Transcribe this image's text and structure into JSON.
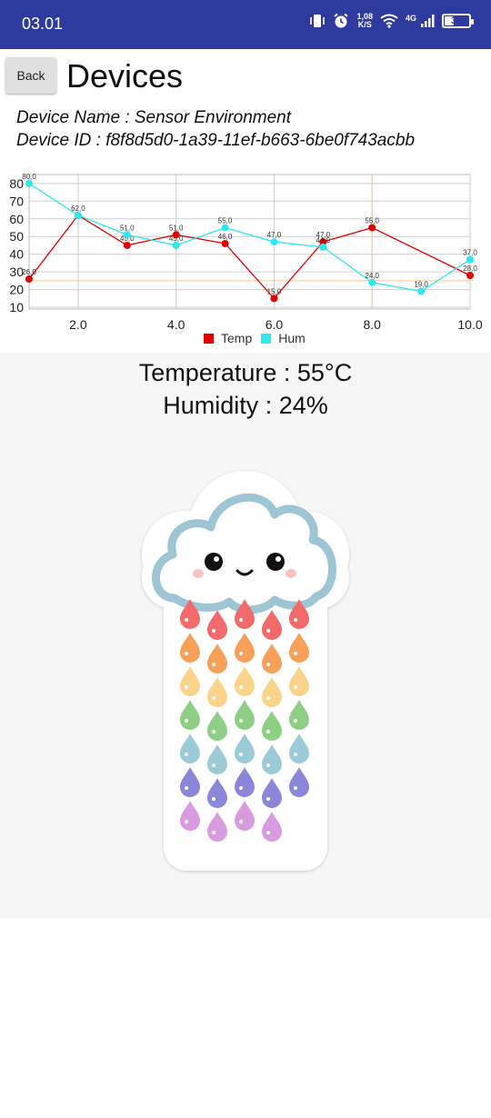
{
  "status_bar": {
    "time": "03.01",
    "net_speed_value": "1,08",
    "net_speed_unit": "K/S",
    "network_type": "4G",
    "battery_level": "37",
    "icons": [
      "vibrate-icon",
      "alarm-icon",
      "wifi-icon",
      "cellular-signal-icon",
      "battery-icon"
    ]
  },
  "header": {
    "back_label": "Back",
    "title": "Devices"
  },
  "device": {
    "name_line": "Device Name : Sensor Environment",
    "id_line": "Device ID : f8f8d5d0-1a39-11ef-b663-6be0f743acbb"
  },
  "chart_data": {
    "type": "line",
    "x": [
      1,
      2,
      3,
      4,
      5,
      6,
      7,
      8,
      9,
      10
    ],
    "x_ticks": [
      "2.0",
      "4.0",
      "6.0",
      "8.0",
      "10.0"
    ],
    "y_ticks": [
      "10",
      "20",
      "30",
      "40",
      "50",
      "60",
      "70",
      "80"
    ],
    "ylim": [
      9,
      83
    ],
    "xlim": [
      1,
      10
    ],
    "grid": true,
    "legend_position": "bottom-center",
    "series": [
      {
        "name": "Temp",
        "color": "#e30000",
        "values": [
          26,
          62,
          45,
          51,
          46,
          15,
          47,
          55,
          null,
          28
        ],
        "labels": [
          "26,0",
          "62,0",
          "45,0",
          "51,0",
          "46,0",
          "15,0",
          "47,0",
          "55,0",
          "",
          "28,0"
        ]
      },
      {
        "name": "Hum",
        "color": "#2ee8ec",
        "values": [
          80,
          62,
          51,
          45,
          55,
          47,
          44,
          24,
          19,
          37
        ],
        "labels": [
          "80,0",
          "",
          "51,0",
          "45,0",
          "55,0",
          "47,0",
          "44,0",
          "24,0",
          "19,0",
          "37,0"
        ]
      }
    ],
    "limit_lines": [
      {
        "axis": "y",
        "value": 25,
        "color": "#f0c890"
      },
      {
        "axis": "x",
        "value": 8,
        "color": "#f0c890"
      }
    ]
  },
  "legend": {
    "temp_label": "Temp",
    "hum_label": "Hum",
    "temp_color": "#e30000",
    "hum_color": "#2ee8ec"
  },
  "readings": {
    "temperature": "Temperature : 55°C",
    "humidity": "Humidity : 24%"
  },
  "illustration": {
    "icon": "rain-cloud-sticker-icon",
    "drop_colors": [
      "#f26a6a",
      "#f7a05a",
      "#fad48a",
      "#8fcf85",
      "#9ccbd8",
      "#8c86d9",
      "#d99be0"
    ]
  }
}
